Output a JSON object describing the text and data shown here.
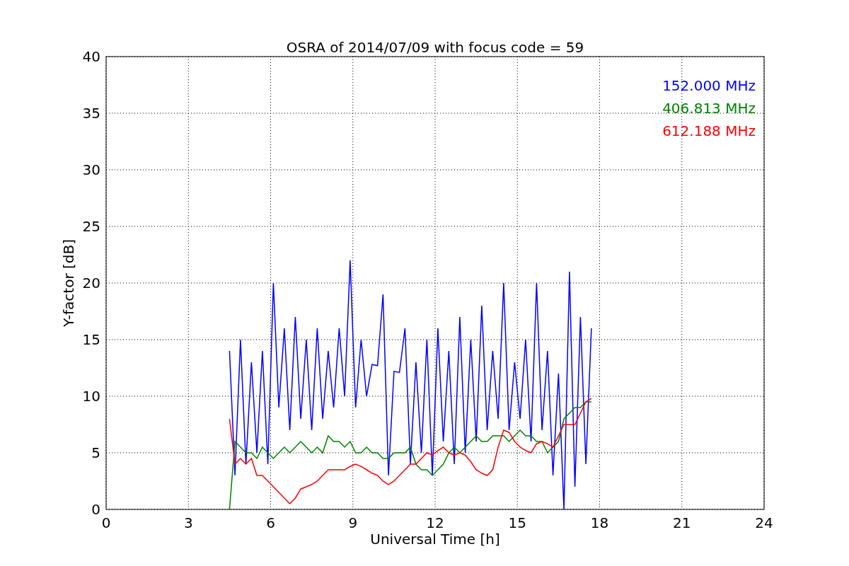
{
  "chart_data": {
    "type": "line",
    "grid": true,
    "title": "OSRA of 2014/07/09 with focus code = 59",
    "xlabel": "Universal Time [h]",
    "ylabel": "Y-factor [dB]",
    "xlim": [
      0,
      24
    ],
    "ylim": [
      0,
      40
    ],
    "xticks": [
      0,
      3,
      6,
      9,
      12,
      15,
      18,
      21,
      24
    ],
    "yticks": [
      0,
      5,
      10,
      15,
      20,
      25,
      30,
      35,
      40
    ],
    "x": [
      4.5,
      4.7,
      4.9,
      5.1,
      5.3,
      5.5,
      5.7,
      5.9,
      6.1,
      6.3,
      6.5,
      6.7,
      6.9,
      7.1,
      7.3,
      7.5,
      7.7,
      7.9,
      8.1,
      8.3,
      8.5,
      8.7,
      8.9,
      9.1,
      9.3,
      9.5,
      9.7,
      9.9,
      10.1,
      10.3,
      10.5,
      10.7,
      10.9,
      11.1,
      11.3,
      11.5,
      11.7,
      11.9,
      12.1,
      12.3,
      12.5,
      12.7,
      12.9,
      13.1,
      13.3,
      13.5,
      13.7,
      13.9,
      14.1,
      14.3,
      14.5,
      14.7,
      14.9,
      15.1,
      15.3,
      15.5,
      15.7,
      15.9,
      16.1,
      16.3,
      16.5,
      16.7,
      16.9,
      17.1,
      17.3,
      17.5,
      17.7
    ],
    "series": [
      {
        "name": "152.000 MHz",
        "color": "#0000ff",
        "values": [
          14,
          3,
          15,
          4,
          13,
          5,
          14,
          4,
          20,
          9,
          16,
          7,
          17,
          8,
          15,
          7,
          16,
          8,
          14,
          9,
          16,
          10,
          22,
          9,
          15,
          10,
          12.8,
          12.7,
          19,
          3,
          12.2,
          12.1,
          16,
          4,
          13,
          5,
          15,
          3,
          16,
          6,
          14,
          4,
          17,
          5,
          15,
          6,
          18,
          7,
          14,
          8,
          20,
          7,
          13,
          8,
          15,
          6,
          20,
          7,
          14,
          3,
          12,
          0,
          21,
          2,
          17,
          4,
          16
        ]
      },
      {
        "name": "406.813 MHz",
        "color": "#008000",
        "values": [
          0,
          6,
          5.5,
          5,
          5,
          4.5,
          5.5,
          5,
          4.5,
          5,
          5.5,
          5,
          5.5,
          6,
          5.5,
          5,
          5.5,
          5,
          6.5,
          6,
          6,
          5.5,
          6,
          5,
          5,
          5.5,
          5,
          5,
          4.5,
          4.5,
          5,
          5,
          5,
          5.5,
          4,
          3.5,
          3.5,
          3,
          3.5,
          4,
          5,
          5.5,
          5,
          5.5,
          6,
          6.5,
          6,
          6,
          6.5,
          6.5,
          6.5,
          6,
          6.5,
          7,
          6.5,
          6.5,
          6,
          6,
          5,
          5.5,
          6,
          8,
          8.5,
          9,
          9,
          9.5,
          9.5
        ]
      },
      {
        "name": "612.188 MHz",
        "color": "#ff0000",
        "values": [
          8,
          4,
          4.5,
          4,
          4.5,
          3,
          3,
          2.5,
          2,
          1.5,
          1,
          0.5,
          1,
          1.8,
          2,
          2.2,
          2.5,
          3,
          3.5,
          3.5,
          3.5,
          3.5,
          3.8,
          4,
          3.8,
          3.5,
          3.2,
          3,
          2.5,
          2.2,
          2.5,
          3,
          3.5,
          4,
          4,
          4.5,
          5,
          4.8,
          5.2,
          5.5,
          5,
          4.8,
          5,
          4.8,
          4.2,
          3.5,
          3.2,
          3,
          3.5,
          5.5,
          7,
          6.8,
          6,
          5.5,
          5.2,
          5,
          5.8,
          6,
          5.8,
          5.5,
          6.5,
          7.5,
          7.5,
          7.5,
          8.5,
          9.5,
          9.8
        ]
      }
    ]
  }
}
